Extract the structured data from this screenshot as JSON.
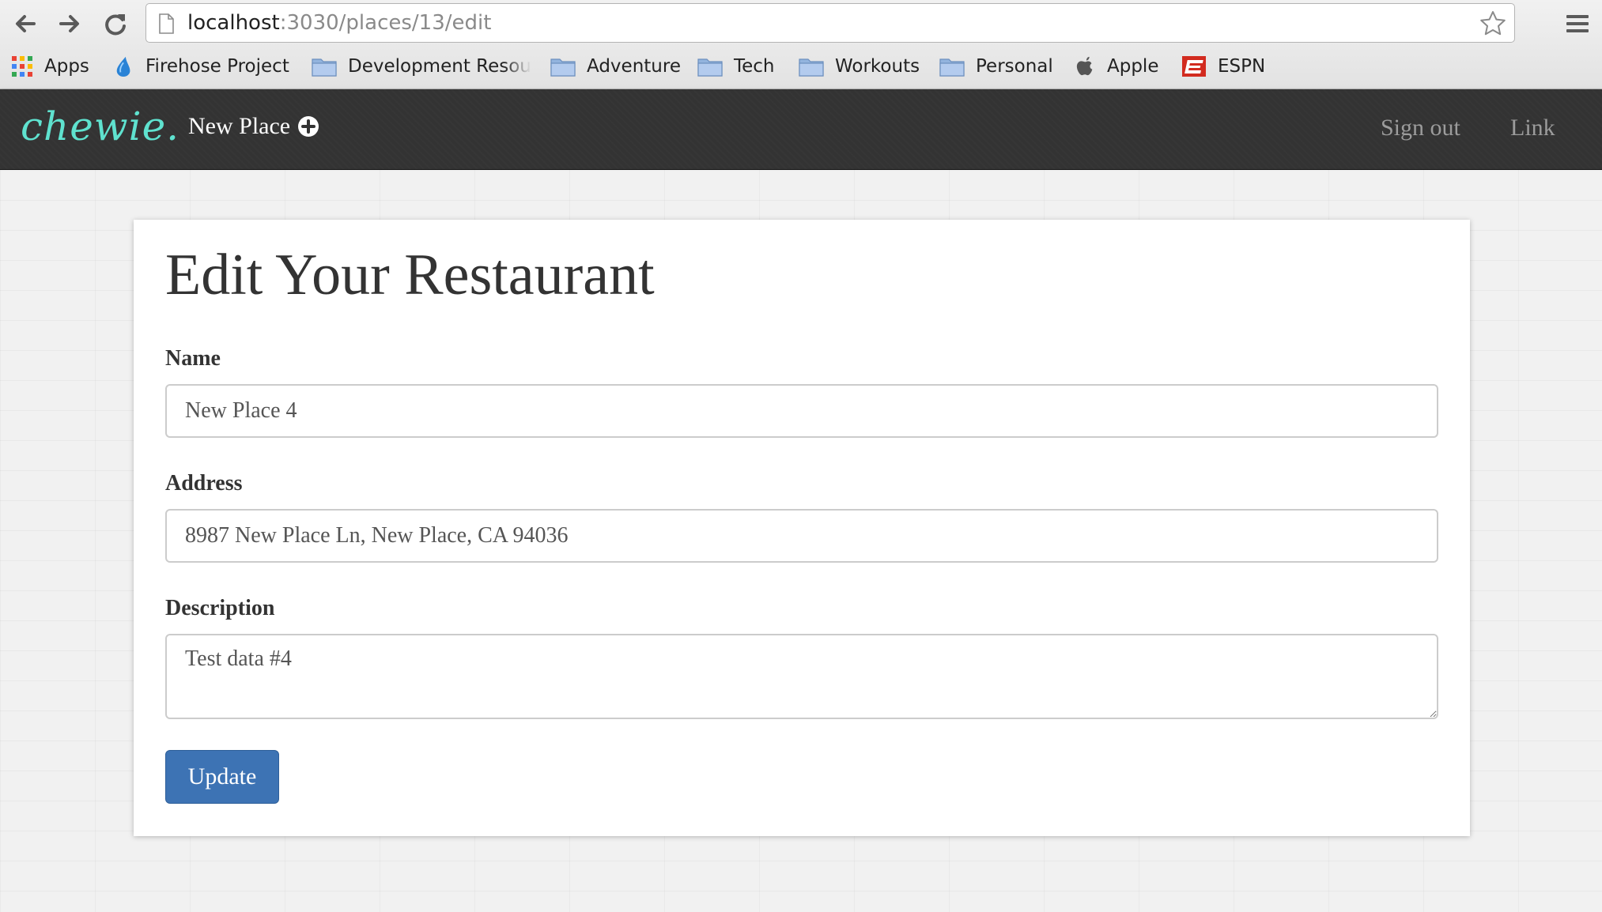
{
  "browser": {
    "url_host": "localhost",
    "url_path": ":3030/places/13/edit",
    "bookmarks": [
      {
        "label": "Apps",
        "icon": "apps-grid-icon"
      },
      {
        "label": "Firehose Project",
        "icon": "firehose-drop-icon"
      },
      {
        "label": "Development Resources",
        "icon": "folder-icon"
      },
      {
        "label": "Adventure",
        "icon": "folder-icon"
      },
      {
        "label": "Tech",
        "icon": "folder-icon"
      },
      {
        "label": "Workouts",
        "icon": "folder-icon"
      },
      {
        "label": "Personal",
        "icon": "folder-icon"
      },
      {
        "label": "Apple",
        "icon": "apple-icon"
      },
      {
        "label": "ESPN",
        "icon": "espn-icon"
      }
    ]
  },
  "navbar": {
    "brand": "chewie.",
    "new_place": "New Place",
    "sign_out": "Sign out",
    "link": "Link"
  },
  "form": {
    "heading": "Edit Your Restaurant",
    "name_label": "Name",
    "name_value": "New Place 4",
    "address_label": "Address",
    "address_value": "8987 New Place Ln, New Place, CA 94036",
    "description_label": "Description",
    "description_value": "Test data #4",
    "submit": "Update"
  },
  "colors": {
    "brand": "#5fe2cf",
    "navbar_bg": "#333333",
    "button": "#3d73b4"
  }
}
